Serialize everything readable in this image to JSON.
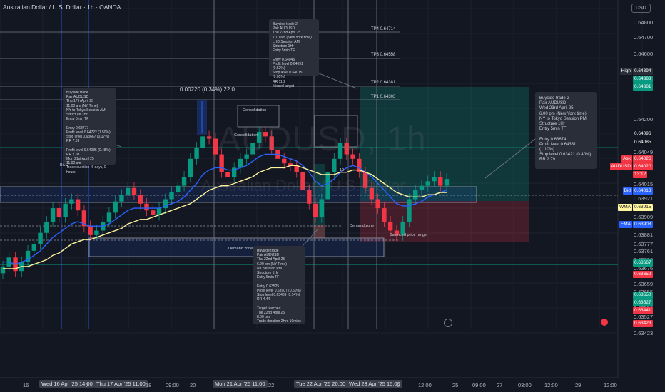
{
  "header": {
    "title": "Australian Dollar / U.S. Dollar · 1h · OANDA",
    "currency_button": "USD"
  },
  "watermark": {
    "symbol": "AUDUSD, 1h",
    "name": "Australian Dollar / U.S. Dollar"
  },
  "chart_data": {
    "type": "candlestick",
    "title": "Australian Dollar / U.S. Dollar · 1h · OANDA",
    "xlabel": "",
    "ylabel": "",
    "ylim": [
      0.6342,
      0.6485
    ],
    "price_axis_labels": [
      "0.64800",
      "0.64700",
      "0.64600",
      "0.64500",
      "0.64200",
      "0.64100",
      "0.64049",
      "0.64015",
      "0.63921",
      "0.63909",
      "0.63881",
      "0.63777",
      "0.63761",
      "0.63700",
      "0.63676",
      "0.63667",
      "0.63659",
      "0.63655",
      "0.63601",
      "0.63550",
      "0.63527",
      "0.63441",
      "0.63423"
    ],
    "time_axis_labels": [
      {
        "text": "16",
        "hl": false
      },
      {
        "text": "Wed 16 Apr '25  14:00",
        "hl": true
      },
      {
        "text": "7",
        "hl": false
      },
      {
        "text": "Thu 17 Apr '25  11:00",
        "hl": true
      },
      {
        "text": "18",
        "hl": false
      },
      {
        "text": "09:00",
        "hl": false
      },
      {
        "text": "20",
        "hl": false
      },
      {
        "text": "Mon 21 Apr '25  11:00",
        "hl": true
      },
      {
        "text": "22",
        "hl": false
      },
      {
        "text": "Tue 22 Apr '25  20:00",
        "hl": true
      },
      {
        "text": "Wed 23 Apr '25  15:00",
        "hl": true
      },
      {
        "text": "0",
        "hl": false
      },
      {
        "text": "12:00",
        "hl": false
      },
      {
        "text": "25",
        "hl": false
      },
      {
        "text": "09:00",
        "hl": false
      },
      {
        "text": "27",
        "hl": false
      },
      {
        "text": "03:00",
        "hl": false
      },
      {
        "text": "12:00",
        "hl": false
      },
      {
        "text": "29",
        "hl": false
      },
      {
        "text": "12:00",
        "hl": false
      }
    ],
    "series": [
      {
        "name": "AUDUSD close",
        "values": [
          0.637,
          0.6374,
          0.6368,
          0.6372,
          0.6377,
          0.638,
          0.6385,
          0.639,
          0.6396,
          0.6392,
          0.6398,
          0.64,
          0.6395,
          0.6388,
          0.6384,
          0.6386,
          0.639,
          0.6394,
          0.6399,
          0.6402,
          0.6405,
          0.6402,
          0.6398,
          0.6395,
          0.6393,
          0.6396,
          0.64,
          0.6403,
          0.6406,
          0.641,
          0.6418,
          0.6423,
          0.6428,
          0.6427,
          0.642,
          0.6412,
          0.641,
          0.6414,
          0.6418,
          0.642,
          0.6425,
          0.643,
          0.6428,
          0.6422,
          0.6418,
          0.6416,
          0.6415,
          0.6412,
          0.6404,
          0.6398,
          0.6392,
          0.64,
          0.6412,
          0.6418,
          0.6425,
          0.642,
          0.6418,
          0.6412,
          0.6405,
          0.64,
          0.6396,
          0.639,
          0.6386,
          0.6384,
          0.639,
          0.64,
          0.6404,
          0.6406,
          0.6408,
          0.641,
          0.6406,
          0.6409
        ]
      },
      {
        "name": "EMA",
        "values": [
          0.6372,
          0.6372,
          0.6371,
          0.6372,
          0.6373,
          0.6375,
          0.6377,
          0.638,
          0.6383,
          0.6385,
          0.6387,
          0.6389,
          0.639,
          0.6389,
          0.6388,
          0.6388,
          0.6388,
          0.6389,
          0.6391,
          0.6393,
          0.6395,
          0.6396,
          0.6396,
          0.6396,
          0.6396,
          0.6396,
          0.6397,
          0.6398,
          0.6399,
          0.6401,
          0.6404,
          0.6407,
          0.6411,
          0.6413,
          0.6414,
          0.6414,
          0.6413,
          0.6413,
          0.6414,
          0.6415,
          0.6417,
          0.6419,
          0.642,
          0.642,
          0.642,
          0.6419,
          0.6418,
          0.6417,
          0.6415,
          0.6412,
          0.6408,
          0.6406,
          0.6407,
          0.6409,
          0.6412,
          0.6414,
          0.6415,
          0.6414,
          0.6412,
          0.641,
          0.6407,
          0.6404,
          0.6401,
          0.6398,
          0.6397,
          0.6397,
          0.6398,
          0.6399,
          0.6401,
          0.6402,
          0.6403,
          0.6404
        ]
      },
      {
        "name": "WMA",
        "values": [
          0.6369,
          0.6369,
          0.6369,
          0.637,
          0.637,
          0.6371,
          0.6372,
          0.6373,
          0.6375,
          0.6376,
          0.6378,
          0.638,
          0.6381,
          0.6382,
          0.6382,
          0.6383,
          0.6384,
          0.6385,
          0.6386,
          0.6387,
          0.6389,
          0.639,
          0.6391,
          0.6391,
          0.6392,
          0.6393,
          0.6394,
          0.6395,
          0.6396,
          0.6397,
          0.6398,
          0.64,
          0.6402,
          0.6404,
          0.6405,
          0.6406,
          0.6406,
          0.6407,
          0.6408,
          0.6409,
          0.641,
          0.6412,
          0.6413,
          0.6414,
          0.6414,
          0.6414,
          0.6415,
          0.6415,
          0.6414,
          0.6413,
          0.6412,
          0.6411,
          0.6411,
          0.6411,
          0.6412,
          0.6412,
          0.6413,
          0.6413,
          0.6412,
          0.6411,
          0.6409,
          0.6407,
          0.6405,
          0.6403,
          0.6402,
          0.6401,
          0.6401,
          0.6401,
          0.6402,
          0.6402,
          0.6403,
          0.6403
        ]
      }
    ],
    "levels": [
      {
        "name": "TP4",
        "text": "TP4 0.64714",
        "price": 0.64714
      },
      {
        "name": "TP3",
        "text": "TP3 0.64558",
        "price": 0.64558
      },
      {
        "name": "TP2",
        "text": "TP2 0.64381",
        "price": 0.64381
      },
      {
        "name": "TP1",
        "text": "TP1 0.64303",
        "price": 0.64303
      }
    ],
    "labels": {
      "bos": "BOS",
      "consolidation1": "Consolidation",
      "consolidation2": "Consolidation",
      "demand_zone1": "Demand zone",
      "demand_zone2": "Demand zone",
      "balanced": "Balanced price range",
      "measure": "0.00220 (0.34%) 22.0",
      "num10": "10"
    },
    "right_tags": [
      {
        "label": "High",
        "value": "0.64394",
        "label_color": "#2a2e39",
        "value_color": "#2a2e39"
      },
      {
        "label": "",
        "value": "0.64383",
        "label_color": "",
        "value_color": "#089981"
      },
      {
        "label": "",
        "value": "0.64381",
        "label_color": "",
        "value_color": "#089981"
      },
      {
        "label": "",
        "value": "0.64096",
        "label_color": "",
        "value_color": "#131722"
      },
      {
        "label": "",
        "value": "0.64085",
        "label_color": "",
        "value_color": "#131722"
      },
      {
        "label": "Ask",
        "value": "0.64026",
        "label_color": "#f23645",
        "value_color": "#f23645"
      },
      {
        "label": "AUDUSD",
        "value": "0.64020",
        "label_color": "#f23645",
        "value_color": "#f23645"
      },
      {
        "label": "",
        "value": "13:12",
        "label_color": "",
        "value_color": "#f23645"
      },
      {
        "label": "Bid",
        "value": "0.64013",
        "label_color": "#2962ff",
        "value_color": "#2962ff"
      },
      {
        "label": "WMA",
        "value": "0.63915",
        "label_color": "#fff59d",
        "value_color": "#fff59d"
      },
      {
        "label": "EMA",
        "value": "0.63908",
        "label_color": "#2962ff",
        "value_color": "#2962ff"
      },
      {
        "label": "",
        "value": "0.63667",
        "label_color": "",
        "value_color": "#089981"
      },
      {
        "label": "",
        "value": "0.63659",
        "label_color": "",
        "value_color": "#f23645"
      },
      {
        "label": "",
        "value": "0.63550",
        "label_color": "",
        "value_color": "#089981"
      },
      {
        "label": "",
        "value": "0.63527",
        "label_color": "",
        "value_color": "#089981"
      },
      {
        "label": "",
        "value": "0.63441",
        "label_color": "",
        "value_color": "#f23645"
      },
      {
        "label": "",
        "value": "0.63423",
        "label_color": "",
        "value_color": "#f23645"
      }
    ],
    "colors": {
      "up": "#089981",
      "down": "#f23645",
      "ema": "#2962ff",
      "wma": "#fff59d",
      "bg": "#131722"
    },
    "grid": true,
    "legend": "none"
  },
  "annotations": {
    "buyside1": "Buyside trade\nPair AUDUSD\nThu 17th April 25\n11.00 am (NY Time)\nNY to Tokyo Session AM\nStructure 1Hr\nEntry 5min TF\n\nEntry 0.63777\nProfit level 0.64722 (1.50%)\nStop level 0.63667 (0.17%)\nRR 7.09\n\nProfit level 0.64085 (0.48%)\nRR 2.08\nMon 21st April 25\n11.00 am\nTrade duration -6 days, 0 hours",
    "buyside2_top": "Buyside trade 2\nPair AUDUSD\nThu 22nd April 25\n7.10 am (New York time)\nLHD Session AM\nStructure 1Hr\nEntry 5min TF\n\nEntry 0.64045\nProfit level 0.64091 (0.52%)\nStop level 0.64015 (0.05%)\nRR 11.2\nMissed target",
    "buyside3": "Buyside trade\nPair AUDUSD\nThu 22nd April 25\n6.20 pm (NY Time)\nNY Session PM\nStructure 1Hr\nEntry 5min TF\n\nEntry 0.63525\nProfit level 0.63907 (0.60%)\nStop level 0.63439 (0.14%)\nRR 4.44\n\nTarget reached\nTue 22nd April 25\n8.00 pm\nTrade duration 2Hrs 10mins",
    "buyside_right": "Buyside trade 2\nPair AUDUSD\nWed 23rd April 25\n6.00 pm (New York time)\nNY to Tokyo Session PM\nStructure 1Hr\nEntry 5min TF\n\nEntry 0.63674\nProfit level 0.64381 (1.10%)\nStop level 0.63421 (0.40%)\nRR 2.79"
  }
}
